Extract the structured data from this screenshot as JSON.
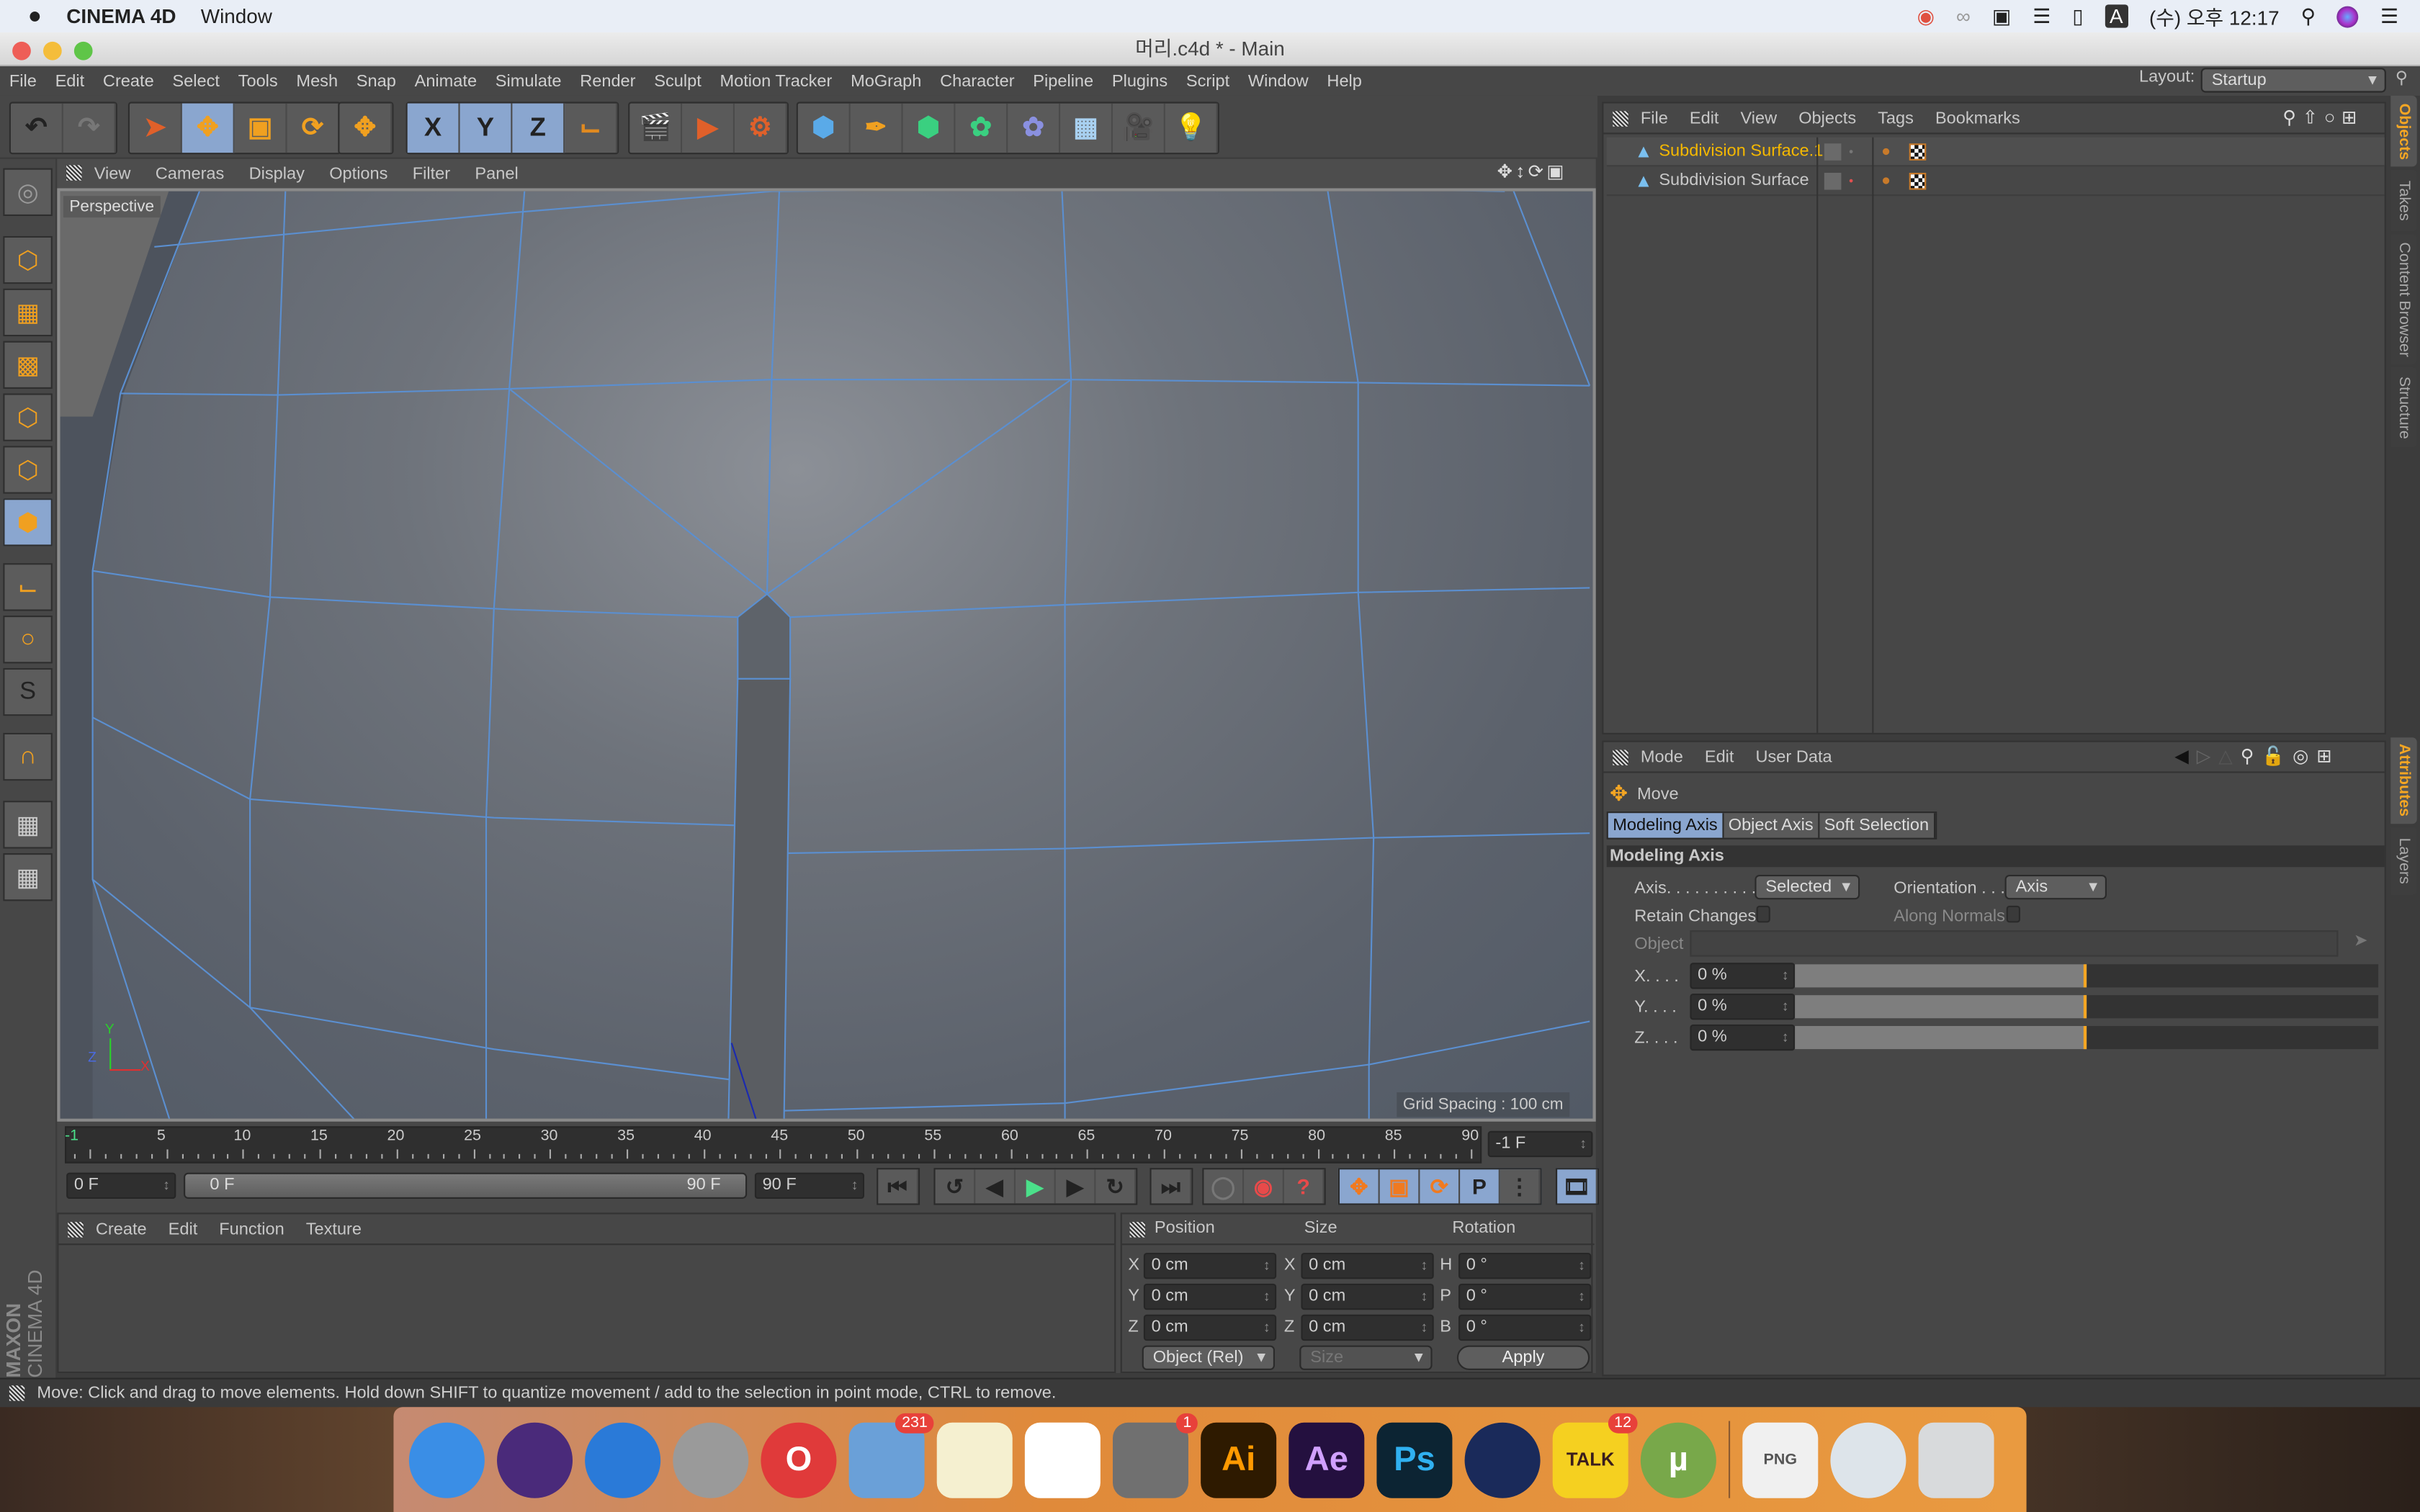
{
  "macos_menubar": {
    "app_name": "CINEMA 4D",
    "menus": [
      "Window"
    ],
    "clock": "(수) 오후 12:17",
    "input_source": "A",
    "status_icons": [
      "naver-talk-icon",
      "creative-cloud-icon",
      "display-icon",
      "wifi-icon",
      "battery-icon",
      "input-source-icon",
      "search-icon",
      "siri-icon",
      "notification-center-icon"
    ]
  },
  "window": {
    "title": "머리.c4d * - Main"
  },
  "app_menu": [
    "File",
    "Edit",
    "Create",
    "Select",
    "Tools",
    "Mesh",
    "Snap",
    "Animate",
    "Simulate",
    "Render",
    "Sculpt",
    "Motion Tracker",
    "MoGraph",
    "Character",
    "Pipeline",
    "Plugins",
    "Script",
    "Window",
    "Help"
  ],
  "layout": {
    "label": "Layout:",
    "value": "Startup"
  },
  "toolbar": {
    "groups": [
      [
        "undo",
        "redo"
      ],
      [
        "live-selection",
        "move",
        "scale",
        "rotate",
        "recent-tool"
      ],
      [
        "x-axis",
        "y-axis",
        "z-axis",
        "coordinate-system"
      ],
      [
        "render-view",
        "render-picture-viewer",
        "render-settings"
      ],
      [
        "cube",
        "pen",
        "subdivision-surface",
        "array",
        "deformer",
        "floor",
        "camera",
        "light"
      ]
    ],
    "axis_labels": [
      "X",
      "Y",
      "Z"
    ]
  },
  "viewport": {
    "menus": [
      "View",
      "Cameras",
      "Display",
      "Options",
      "Filter",
      "Panel"
    ],
    "camera_label": "Perspective",
    "grid_spacing": "Grid Spacing : 100 cm",
    "axis_labels": [
      "Y",
      "Z",
      "X"
    ],
    "accent": "#5b8fd0"
  },
  "left_tools": [
    "make-editable",
    "model-mode",
    "texture-mode",
    "workplane-mode",
    "points-mode",
    "edges-mode",
    "polygons-mode",
    "axis-mode",
    "tweak-mode",
    "solo-mode",
    "snap",
    "lock-workplane",
    "planar-workplane"
  ],
  "objects_panel": {
    "menus": [
      "File",
      "Edit",
      "View",
      "Objects",
      "Tags",
      "Bookmarks"
    ],
    "items": [
      {
        "name": "Subdivision Surface.1",
        "selected": true,
        "color": "#f5b800"
      },
      {
        "name": "Subdivision Surface",
        "selected": false,
        "color": "#c8c8c8"
      }
    ]
  },
  "side_tabs_top": [
    "Objects",
    "Takes",
    "Content Browser",
    "Structure"
  ],
  "side_tabs_bottom": [
    "Attributes",
    "Layers"
  ],
  "attributes": {
    "menus": [
      "Mode",
      "Edit",
      "User Data"
    ],
    "tool_name": "Move",
    "tabs": [
      "Modeling Axis",
      "Object Axis",
      "Soft Selection"
    ],
    "active_tab": 0,
    "section": "Modeling Axis",
    "axis_label": "Axis. . . . . . . . . .",
    "axis_value": "Selected",
    "orientation_label": "Orientation . . .",
    "orientation_value": "Axis",
    "retain_changes": "Retain Changes",
    "along_normals": "Along Normals",
    "object_label": "Object",
    "sliders": [
      {
        "label": "X. . . .",
        "value": "0 %",
        "level": 0.5
      },
      {
        "label": "Y. . . .",
        "value": "0 %",
        "level": 0.5
      },
      {
        "label": "Z. . . .",
        "value": "0 %",
        "level": 0.5
      }
    ]
  },
  "timeline": {
    "ticks": [
      "-1",
      "5",
      "10",
      "15",
      "20",
      "25",
      "30",
      "35",
      "40",
      "45",
      "50",
      "55",
      "60",
      "65",
      "70",
      "75",
      "80",
      "85",
      "90"
    ],
    "current_frame": "-1 F",
    "start": "0 F",
    "range_start": "0 F",
    "range_end": "90 F",
    "end": "90 F"
  },
  "materials_panel": {
    "menus": [
      "Create",
      "Edit",
      "Function",
      "Texture"
    ]
  },
  "coordinates": {
    "headers": [
      "Position",
      "Size",
      "Rotation"
    ],
    "rows": [
      {
        "pl": "X",
        "pv": "0 cm",
        "sl": "X",
        "sv": "0 cm",
        "rl": "H",
        "rv": "0 °"
      },
      {
        "pl": "Y",
        "pv": "0 cm",
        "sl": "Y",
        "sv": "0 cm",
        "rl": "P",
        "rv": "0 °"
      },
      {
        "pl": "Z",
        "pv": "0 cm",
        "sl": "Z",
        "sv": "0 cm",
        "rl": "B",
        "rv": "0 °"
      }
    ],
    "mode": "Object (Rel)",
    "size_mode": "Size",
    "apply": "Apply"
  },
  "brand": {
    "maxon": "MAXON",
    "product": "CINEMA 4D"
  },
  "status_bar": "Move: Click and drag to move elements. Hold down SHIFT to quantize movement / add to the selection in point mode, CTRL to remove.",
  "dock": [
    {
      "name": "Finder",
      "label": "",
      "color": "#3a8ee6"
    },
    {
      "name": "Siri",
      "label": "",
      "color": "#4a2a7a"
    },
    {
      "name": "Safari",
      "label": "",
      "color": "#2a7ad8"
    },
    {
      "name": "Launchpad",
      "label": "",
      "color": "#9a9a9a"
    },
    {
      "name": "Opera",
      "label": "O",
      "color": "#e03a3a"
    },
    {
      "name": "Mail",
      "label": "",
      "color": "#6aa0d8",
      "badge": "231"
    },
    {
      "name": "Notes",
      "label": "",
      "color": "#f5f0d0"
    },
    {
      "name": "Whale",
      "label": "",
      "color": "#ffffff"
    },
    {
      "name": "System Preferences",
      "label": "",
      "color": "#707070",
      "badge": "1"
    },
    {
      "name": "Illustrator",
      "label": "Ai",
      "color": "#2e1a00"
    },
    {
      "name": "After Effects",
      "label": "Ae",
      "color": "#24103f"
    },
    {
      "name": "Photoshop",
      "label": "Ps",
      "color": "#0c2433"
    },
    {
      "name": "Cinema 4D",
      "label": "",
      "color": "#1a2a5a"
    },
    {
      "name": "KakaoTalk",
      "label": "TALK",
      "color": "#f5d020",
      "badge": "12"
    },
    {
      "name": "uTorrent",
      "label": "µ",
      "color": "#78a84a"
    },
    {
      "name": "PNG file",
      "label": "PNG",
      "color": "#f0f0f0"
    },
    {
      "name": "Safari window",
      "label": "",
      "color": "#dde4ea"
    },
    {
      "name": "Trash",
      "label": "",
      "color": "#d8dadc"
    }
  ]
}
